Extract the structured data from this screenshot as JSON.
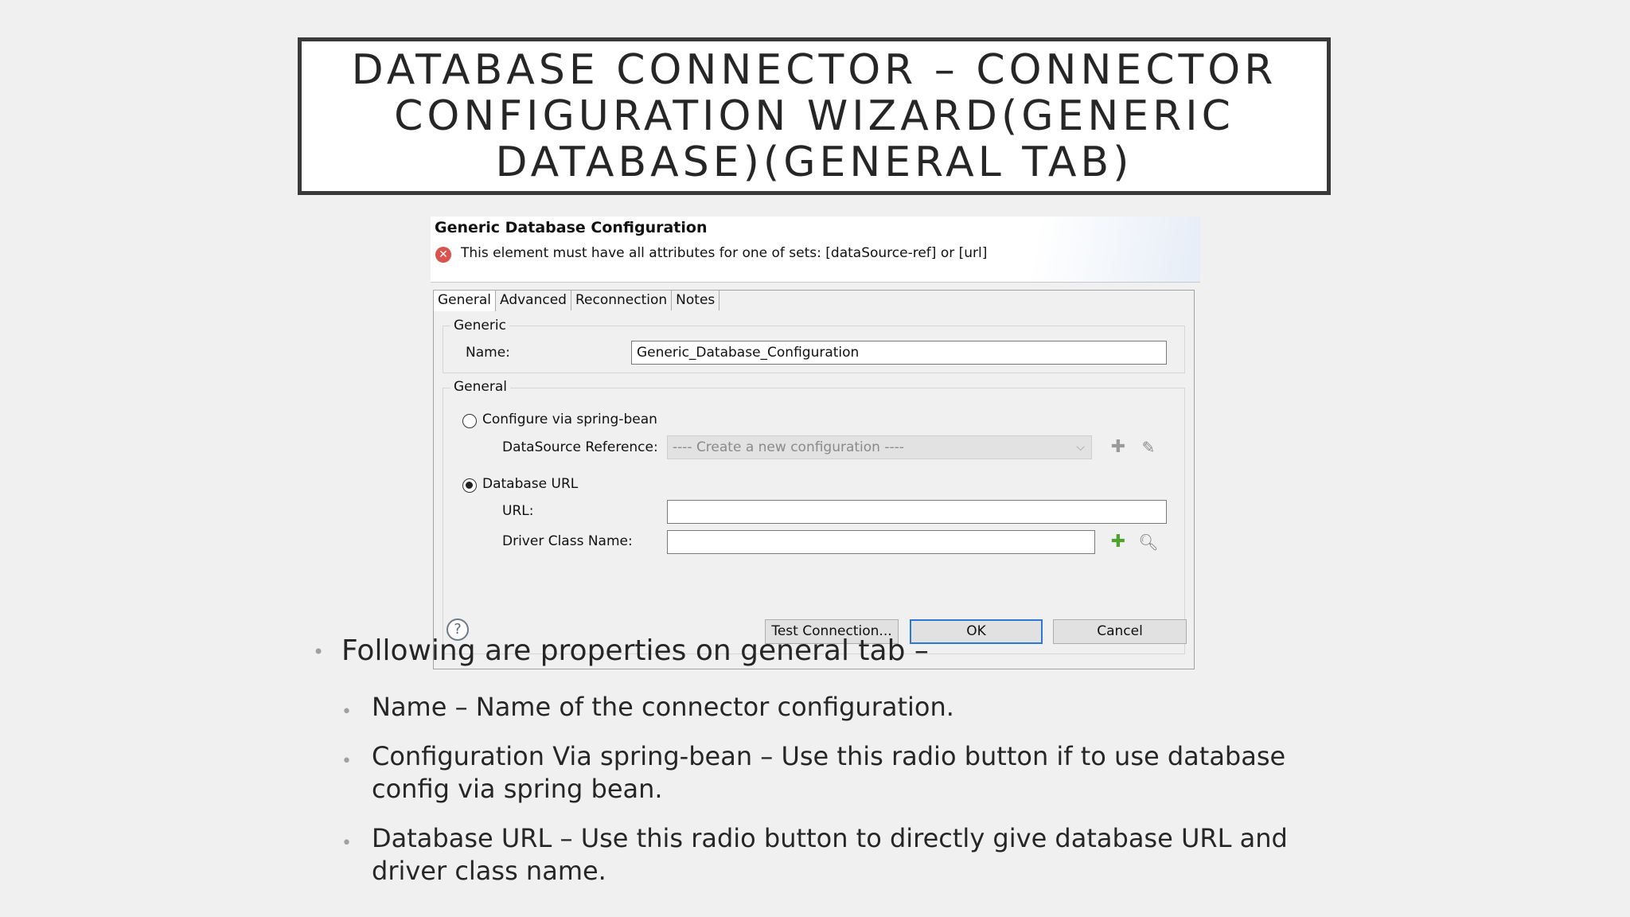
{
  "slide": {
    "title": "DATABASE CONNECTOR – CONNECTOR CONFIGURATION WIZARD(GENERIC DATABASE)(GENERAL TAB)"
  },
  "dialog": {
    "title": "Generic Database Configuration",
    "error_message": "This element must have all attributes for one of sets: [dataSource-ref] or [url]",
    "tabs": [
      "General",
      "Advanced",
      "Reconnection",
      "Notes"
    ],
    "active_tab": "General",
    "generic_group": {
      "label": "Generic",
      "name_label": "Name:",
      "name_value": "Generic_Database_Configuration"
    },
    "general_group": {
      "label": "General",
      "spring_bean_radio": "Configure via spring-bean",
      "spring_bean_selected": false,
      "datasource_label": "DataSource Reference:",
      "datasource_value": "---- Create a new configuration ----",
      "db_url_radio": "Database URL",
      "db_url_selected": true,
      "url_label": "URL:",
      "url_value": "",
      "driver_label": "Driver Class Name:",
      "driver_value": ""
    },
    "buttons": {
      "test_connection": "Test Connection...",
      "ok": "OK",
      "cancel": "Cancel"
    },
    "icons": {
      "error": "error-icon",
      "help": "help-icon",
      "add": "add-icon",
      "edit": "edit-icon",
      "search": "search-icon"
    }
  },
  "bullets": {
    "main": "Following are properties on general tab –",
    "items": [
      "Name – Name of the connector configuration.",
      "Configuration Via spring-bean – Use this radio button if to use database config via spring bean.",
      "Database URL – Use this radio button to directly give database URL and driver class name."
    ]
  }
}
